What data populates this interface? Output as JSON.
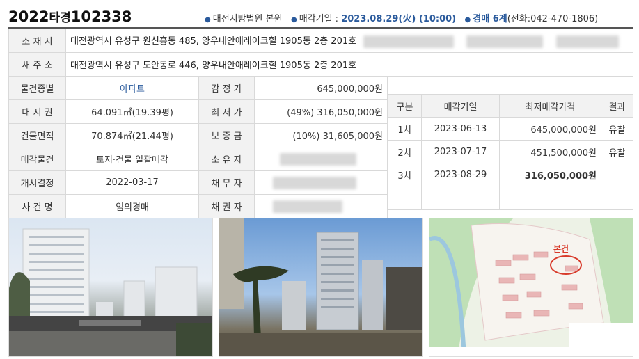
{
  "header": {
    "case_year": "2022",
    "case_type": "타경",
    "case_number": "102338",
    "court": "대전지방법원 본원",
    "sale_date_label": "매각기일 : ",
    "sale_date": "2023.08.29(火) (10:00)",
    "dept": "경매 6계",
    "phone": "(전화:042-470-1806)"
  },
  "fields": {
    "location_label": "소 재 지",
    "location_value": "대전광역시 유성구 원신흥동 485, 양우내안애레이크힐 1905동 2층 201호",
    "new_address_label": "새 주 소",
    "new_address_value": "대전광역시 유성구 도안동로 446, 양우내안애레이크힐 1905동 2층 201호",
    "type_label": "물건종별",
    "type_value": "아파트",
    "appraisal_label": "감 정 가",
    "appraisal_value": "645,000,000원",
    "land_label": "대 지 권",
    "land_value": "64.091㎡(19.39평)",
    "min_price_label": "최 저 가",
    "min_price_value": "(49%) 316,050,000원",
    "building_label": "건물면적",
    "building_value": "70.874㎡(21.44평)",
    "deposit_label": "보 증 금",
    "deposit_value": "(10%) 31,605,000원",
    "sale_item_label": "매각물건",
    "sale_item_value": "토지·건물 일괄매각",
    "owner_label": "소 유 자",
    "start_label": "개시결정",
    "start_value": "2022-03-17",
    "debtor_label": "채 무 자",
    "case_name_label": "사 건 명",
    "case_name_value": "임의경매",
    "creditor_label": "채 권 자"
  },
  "history": {
    "headers": [
      "구분",
      "매각기일",
      "최저매각가격",
      "결과"
    ],
    "rows": [
      {
        "round": "1차",
        "date": "2023-06-13",
        "price": "645,000,000원",
        "result": "유찰"
      },
      {
        "round": "2차",
        "date": "2023-07-17",
        "price": "451,500,000원",
        "result": "유찰"
      },
      {
        "round": "3차",
        "date": "2023-08-29",
        "price": "316,050,000원",
        "result": ""
      }
    ]
  },
  "map": {
    "marker_label": "본건"
  },
  "colors": {
    "accent_blue": "#2a5a9c",
    "label_bg": "#f2f2f2",
    "border": "#d9d9d9"
  }
}
